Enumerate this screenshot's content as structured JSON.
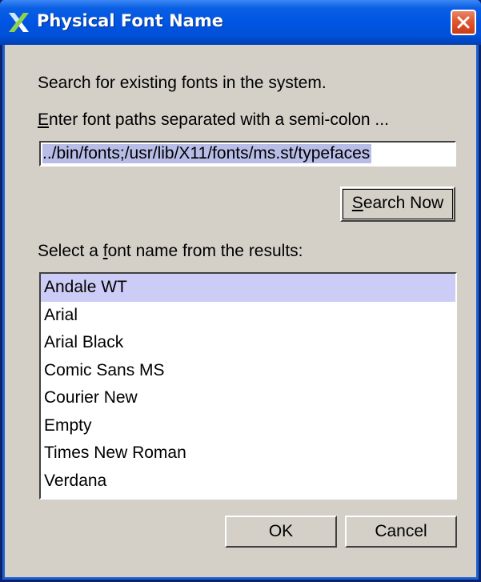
{
  "window": {
    "title": "Physical Font Name"
  },
  "content": {
    "description": "Search for existing fonts in the system.",
    "paths_label_mnemonic": "E",
    "paths_label_rest": "nter font paths separated with a semi-colon ...",
    "paths_value": "../bin/fonts;/usr/lib/X11/fonts/ms.st/typefaces",
    "search_button_mnemonic": "S",
    "search_button_rest": "earch Now",
    "results_label_pre": "Select a ",
    "results_label_mnemonic": "f",
    "results_label_post": "ont name from the results:"
  },
  "results": {
    "items": [
      {
        "label": "Andale WT",
        "selected": true
      },
      {
        "label": "Arial",
        "selected": false
      },
      {
        "label": "Arial Black",
        "selected": false
      },
      {
        "label": "Comic Sans MS",
        "selected": false
      },
      {
        "label": "Courier New",
        "selected": false
      },
      {
        "label": "Empty",
        "selected": false
      },
      {
        "label": "Times New Roman",
        "selected": false
      },
      {
        "label": "Verdana",
        "selected": false
      }
    ]
  },
  "footer": {
    "ok_label": "OK",
    "cancel_label": "Cancel"
  },
  "colors": {
    "titlebar": "#0054e3",
    "dialog_background": "#d4d0c8",
    "selection": "#ccccf6",
    "close_button": "#e05a35"
  },
  "icons": {
    "title_icon": "x-logo-icon",
    "close_icon": "close-icon"
  }
}
